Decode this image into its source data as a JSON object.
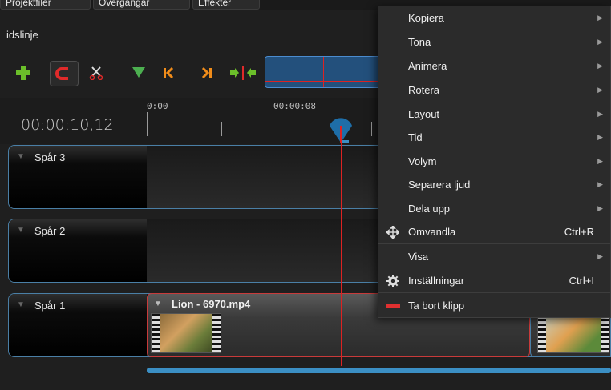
{
  "tabs": [
    "Projektfiler",
    "Övergångar",
    "Effekter"
  ],
  "panel": {
    "title": "idslinje"
  },
  "timecode": "00:00:10,12",
  "ruler": {
    "labels": [
      "0:00",
      "00:00:08"
    ]
  },
  "tracks": [
    {
      "name": "Spår 3"
    },
    {
      "name": "Spår 2"
    },
    {
      "name": "Spår 1"
    }
  ],
  "clip": {
    "title": "Lion - 6970.mp4"
  },
  "context_menu": {
    "items": [
      {
        "label": "Kopiera",
        "submenu": true
      },
      {
        "label": "Tona",
        "submenu": true
      },
      {
        "label": "Animera",
        "submenu": true
      },
      {
        "label": "Rotera",
        "submenu": true
      },
      {
        "label": "Layout",
        "submenu": true
      },
      {
        "label": "Tid",
        "submenu": true
      },
      {
        "label": "Volym",
        "submenu": true
      },
      {
        "label": "Separera ljud",
        "submenu": true
      },
      {
        "label": "Dela upp",
        "submenu": true
      },
      {
        "label": "Omvandla",
        "shortcut": "Ctrl+R",
        "icon": "move-arrows-icon"
      },
      {
        "label": "Visa",
        "submenu": true
      },
      {
        "label": "Inställningar",
        "shortcut": "Ctrl+I",
        "icon": "gear-icon"
      },
      {
        "label": "Ta bort klipp",
        "icon": "remove-clip-icon"
      }
    ]
  },
  "colors": {
    "accent_blue": "#3b8fc4",
    "playhead_red": "#dd2222",
    "add_green": "#6bbf2a",
    "marker_orange": "#f08c1a"
  }
}
